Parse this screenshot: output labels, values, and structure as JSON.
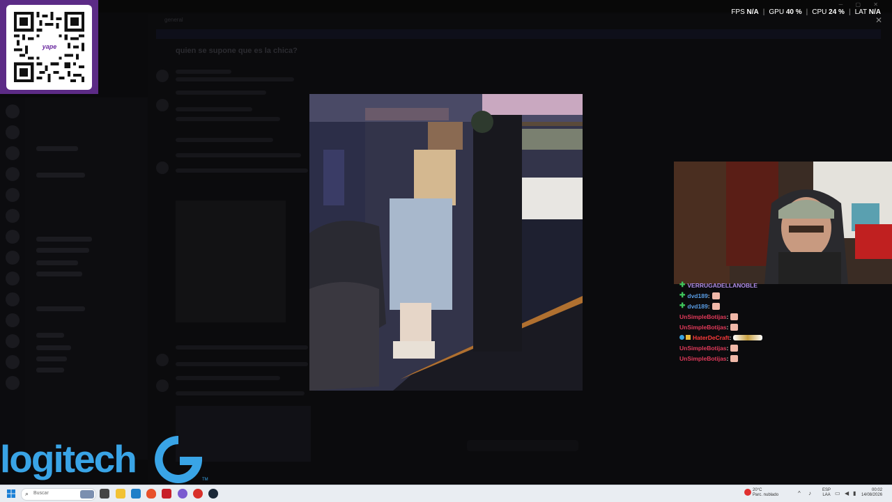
{
  "performance": {
    "fps_label": "FPS",
    "fps_value": "N/A",
    "gpu_label": "GPU",
    "gpu_value": "40 %",
    "cpu_label": "CPU",
    "cpu_value": "24 %",
    "lat_label": "LAT",
    "lat_value": "N/A",
    "separator": "|"
  },
  "background_app": {
    "title": "quien se supone que es la chica?",
    "tab_name": "general"
  },
  "qr": {
    "brand": "yape"
  },
  "chat": {
    "messages": [
      {
        "user": "VERRUGADELLANOBLE",
        "badge": "plus",
        "color": "#b08de8",
        "emote": "none"
      },
      {
        "user": "dvd189",
        "badge": "plus",
        "color": "#5a9ee6",
        "emote": "face"
      },
      {
        "user": "dvd189",
        "badge": "plus",
        "color": "#5a9ee6",
        "emote": "face"
      },
      {
        "user": "UnSimpleBotijas",
        "badge": "none",
        "color": "#e23a5a",
        "emote": "face"
      },
      {
        "user": "UnSimpleBotijas",
        "badge": "none",
        "color": "#e23a5a",
        "emote": "face"
      },
      {
        "user": "HaterDeCraft",
        "badge": "blue-yellow",
        "color": "#ff3b3b",
        "emote": "long"
      },
      {
        "user": "UnSimpleBotijas",
        "badge": "none",
        "color": "#e23a5a",
        "emote": "face"
      },
      {
        "user": "UnSimpleBotijas",
        "badge": "none",
        "color": "#e23a5a",
        "emote": "face"
      }
    ],
    "separator": ":"
  },
  "sponsor": {
    "logo_text": "logitech",
    "tm": "TM",
    "color": "#39a4e6"
  },
  "taskbar": {
    "search_placeholder": "Buscar",
    "weather_temp": "20°C",
    "weather_desc": "Parc. nublado",
    "lang_top": "ESP",
    "lang_bottom": "LAA",
    "time": "00:02",
    "date": "14/08/2026"
  },
  "colors": {
    "accent": "#39a4e6",
    "overlay_bg": "#050505",
    "qr_frame": "#5c2b86"
  }
}
